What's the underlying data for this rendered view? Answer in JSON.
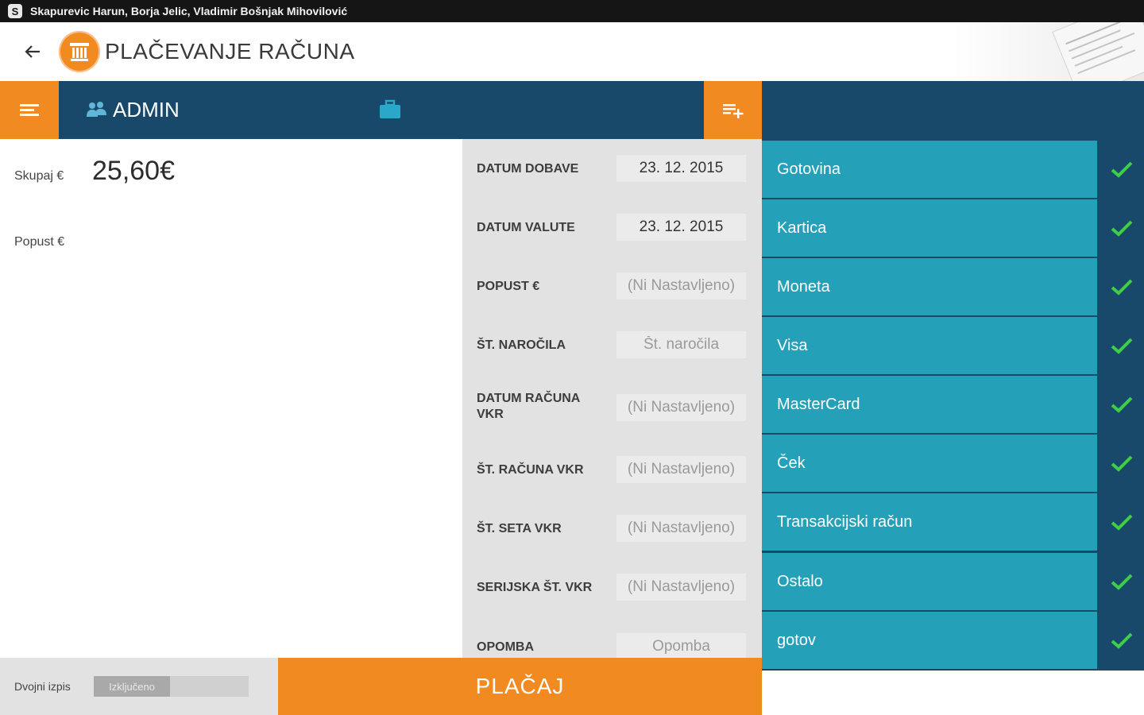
{
  "status_bar": {
    "text": "Skapurevic Harun, Borja Jelic, Vladimir Bošnjak Mihovilović"
  },
  "action_bar": {
    "title": "PLAČEVANJE RAČUNA"
  },
  "toolbar": {
    "user_label": "ADMIN"
  },
  "summary": {
    "total_label": "Skupaj €",
    "total_value": "25,60€",
    "discount_label": "Popust €"
  },
  "form": {
    "fields": [
      {
        "label": "DATUM DOBAVE",
        "value": "23. 12. 2015",
        "placeholder": ""
      },
      {
        "label": "DATUM VALUTE",
        "value": "23. 12. 2015",
        "placeholder": ""
      },
      {
        "label": "POPUST €",
        "value": "(Ni Nastavljeno)",
        "placeholder": ""
      },
      {
        "label": "ŠT. NAROČILA",
        "value": "",
        "placeholder": "Št. naročila"
      },
      {
        "label": "DATUM RAČUNA VKR",
        "value": "(Ni Nastavljeno)",
        "placeholder": ""
      },
      {
        "label": "ŠT. RAČUNA VKR",
        "value": "(Ni Nastavljeno)",
        "placeholder": ""
      },
      {
        "label": "ŠT. SETA VKR",
        "value": "(Ni Nastavljeno)",
        "placeholder": ""
      },
      {
        "label": "SERIJSKA ŠT. VKR",
        "value": "(Ni Nastavljeno)",
        "placeholder": ""
      },
      {
        "label": "OPOMBA",
        "value": "",
        "placeholder": "Opomba"
      }
    ]
  },
  "payment_methods": [
    {
      "name": "Gotovina",
      "checked": true
    },
    {
      "name": "Kartica",
      "checked": true
    },
    {
      "name": "Moneta",
      "checked": true
    },
    {
      "name": "Visa",
      "checked": true
    },
    {
      "name": "MasterCard",
      "checked": true
    },
    {
      "name": "Ček",
      "checked": true
    },
    {
      "name": "Transakcijski račun",
      "checked": true
    },
    {
      "name": "Ostalo",
      "checked": true
    },
    {
      "name": "gotov",
      "checked": true
    }
  ],
  "bottom": {
    "dual_print_label": "Dvojni izpis",
    "dual_print_state": "Izključeno",
    "pay_button": "PLAČAJ"
  },
  "colors": {
    "accent": "#f28a22",
    "navy": "#19496a",
    "teal": "#24a1b9",
    "check": "#3ecf4a"
  },
  "icons": {
    "status_app": "skype-icon",
    "back": "back-arrow-icon",
    "logo": "bank-building-icon",
    "menu": "menu-icon",
    "user": "users-group-icon",
    "briefcase": "briefcase-icon",
    "add_list": "playlist-add-icon",
    "check": "checkmark-icon"
  }
}
